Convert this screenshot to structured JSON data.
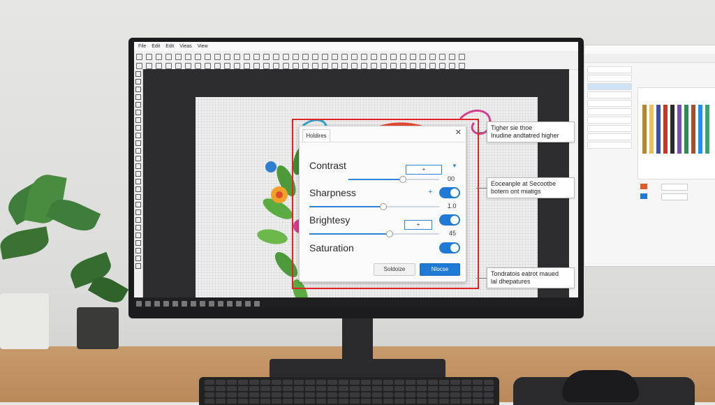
{
  "app": {
    "menus": [
      "File",
      "Edit",
      "Edit",
      "Vieas",
      "View"
    ]
  },
  "dialog": {
    "tab": "Holdires",
    "close": "✕",
    "controls": [
      {
        "label": "Contrast",
        "value": "00",
        "level": 0.6
      },
      {
        "label": "Sharpness",
        "value": "1.0",
        "level": 0.57
      },
      {
        "label": "Brightesy",
        "value": "45",
        "level": 0.62
      },
      {
        "label": "Saturation",
        "value": ""
      }
    ],
    "sharpness_plus": "+",
    "contrast_box": "+",
    "brightness_box": "+",
    "cancel_label": "Soldoize",
    "ok_label": "Nlocse"
  },
  "callouts": [
    {
      "line1": "Tigher sie thoe",
      "line2": "Inudine andtatred higher"
    },
    {
      "line1": "Eoceanple at Secootbe",
      "line2": "botern ont miatigs"
    },
    {
      "line1": "Tondratois eatrot maued",
      "line2": "lal dhepatures"
    }
  ],
  "colors": {
    "accent": "#1f7ad6",
    "highlight": "#e02424"
  }
}
